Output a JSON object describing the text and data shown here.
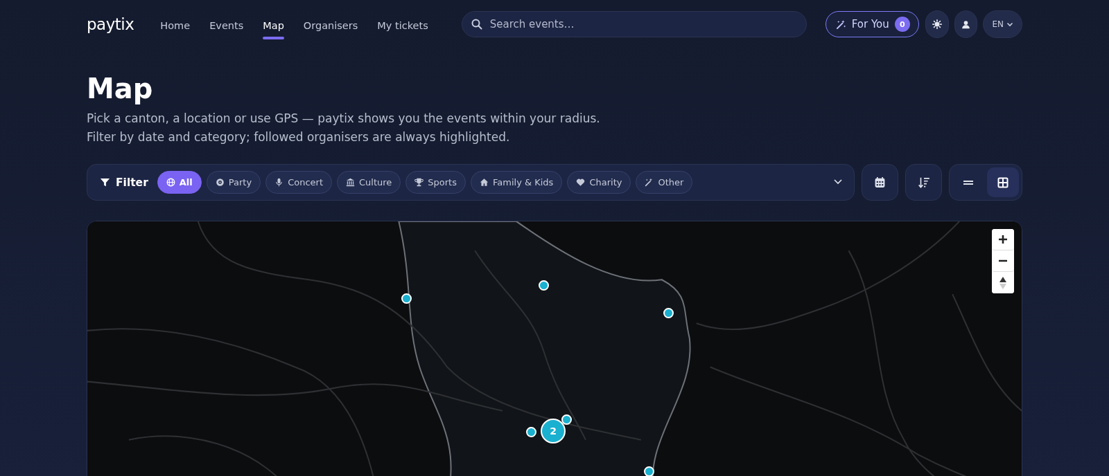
{
  "header": {
    "logo": "paytix",
    "nav": [
      {
        "label": "Home",
        "selected": false
      },
      {
        "label": "Events",
        "selected": false
      },
      {
        "label": "Map",
        "selected": true
      },
      {
        "label": "Organisers",
        "selected": false
      },
      {
        "label": "My tickets",
        "selected": false
      }
    ],
    "search": {
      "placeholder": "Search events…"
    },
    "for_you": {
      "label": "For You",
      "badge": "0"
    },
    "language": "EN"
  },
  "page": {
    "title": "Map",
    "description": [
      "Pick a canton, a location or use GPS — paytix shows you the events within your radius.",
      "Filter by date and category; followed organisers are always highlighted."
    ]
  },
  "filter": {
    "label": "Filter",
    "categories": [
      {
        "label": "All",
        "kind": "globe",
        "selected": true
      },
      {
        "label": "Party",
        "kind": "disc",
        "selected": false
      },
      {
        "label": "Concert",
        "kind": "mic",
        "selected": false
      },
      {
        "label": "Culture",
        "kind": "museum",
        "selected": false
      },
      {
        "label": "Sports",
        "kind": "trophy",
        "selected": false
      },
      {
        "label": "Family & Kids",
        "kind": "home",
        "selected": false
      },
      {
        "label": "Charity",
        "kind": "heart",
        "selected": false
      },
      {
        "label": "Other",
        "kind": "wand",
        "selected": false
      }
    ],
    "views": [
      {
        "kind": "list",
        "selected": false
      },
      {
        "kind": "grid",
        "selected": true
      }
    ]
  },
  "map": {
    "cluster_count": "2"
  }
}
